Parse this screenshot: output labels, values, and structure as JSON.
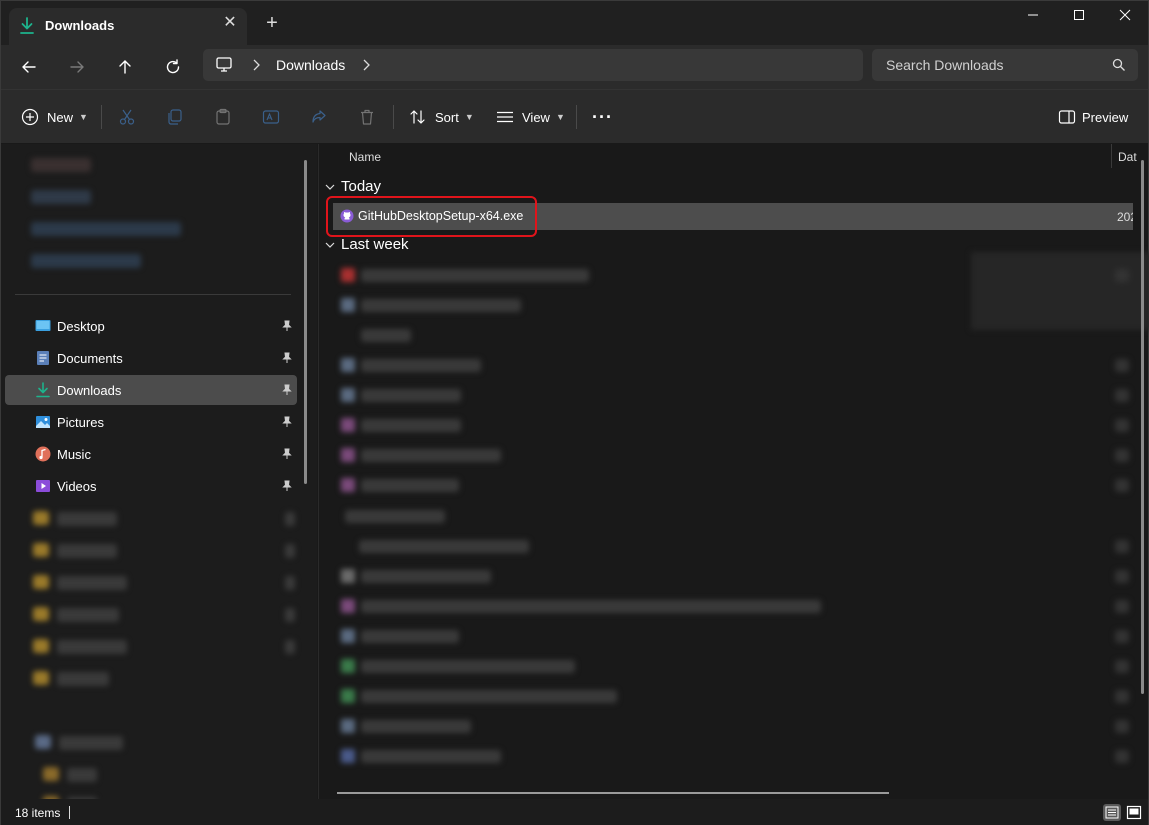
{
  "window": {
    "tab_title": "Downloads",
    "tab_close_symbol": "✕",
    "new_tab_symbol": "+"
  },
  "address": {
    "breadcrumb": "Downloads",
    "search_placeholder": "Search Downloads"
  },
  "toolbar": {
    "new_label": "New",
    "sort_label": "Sort",
    "view_label": "View",
    "preview_label": "Preview",
    "more_label": "···"
  },
  "sidebar": {
    "items": [
      {
        "label": "Desktop",
        "icon": "desktop-icon",
        "pinned": true
      },
      {
        "label": "Documents",
        "icon": "documents-icon",
        "pinned": true
      },
      {
        "label": "Downloads",
        "icon": "downloads-icon",
        "pinned": true,
        "selected": true
      },
      {
        "label": "Pictures",
        "icon": "pictures-icon",
        "pinned": true
      },
      {
        "label": "Music",
        "icon": "music-icon",
        "pinned": true
      },
      {
        "label": "Videos",
        "icon": "videos-icon",
        "pinned": true
      }
    ]
  },
  "list": {
    "columns": {
      "name": "Name",
      "date": "Dat"
    },
    "groups": [
      {
        "label": "Today"
      },
      {
        "label": "Last week"
      }
    ],
    "selected_file": {
      "name": "GitHubDesktopSetup-x64.exe",
      "date": "202",
      "icon": "github-icon"
    }
  },
  "status": {
    "item_count": "18 items"
  },
  "colors": {
    "accent_download": "#1db38c",
    "highlight_box": "#e0141b",
    "selected_row": "#4d4d4d",
    "github_purple": "#8a5cd6"
  }
}
